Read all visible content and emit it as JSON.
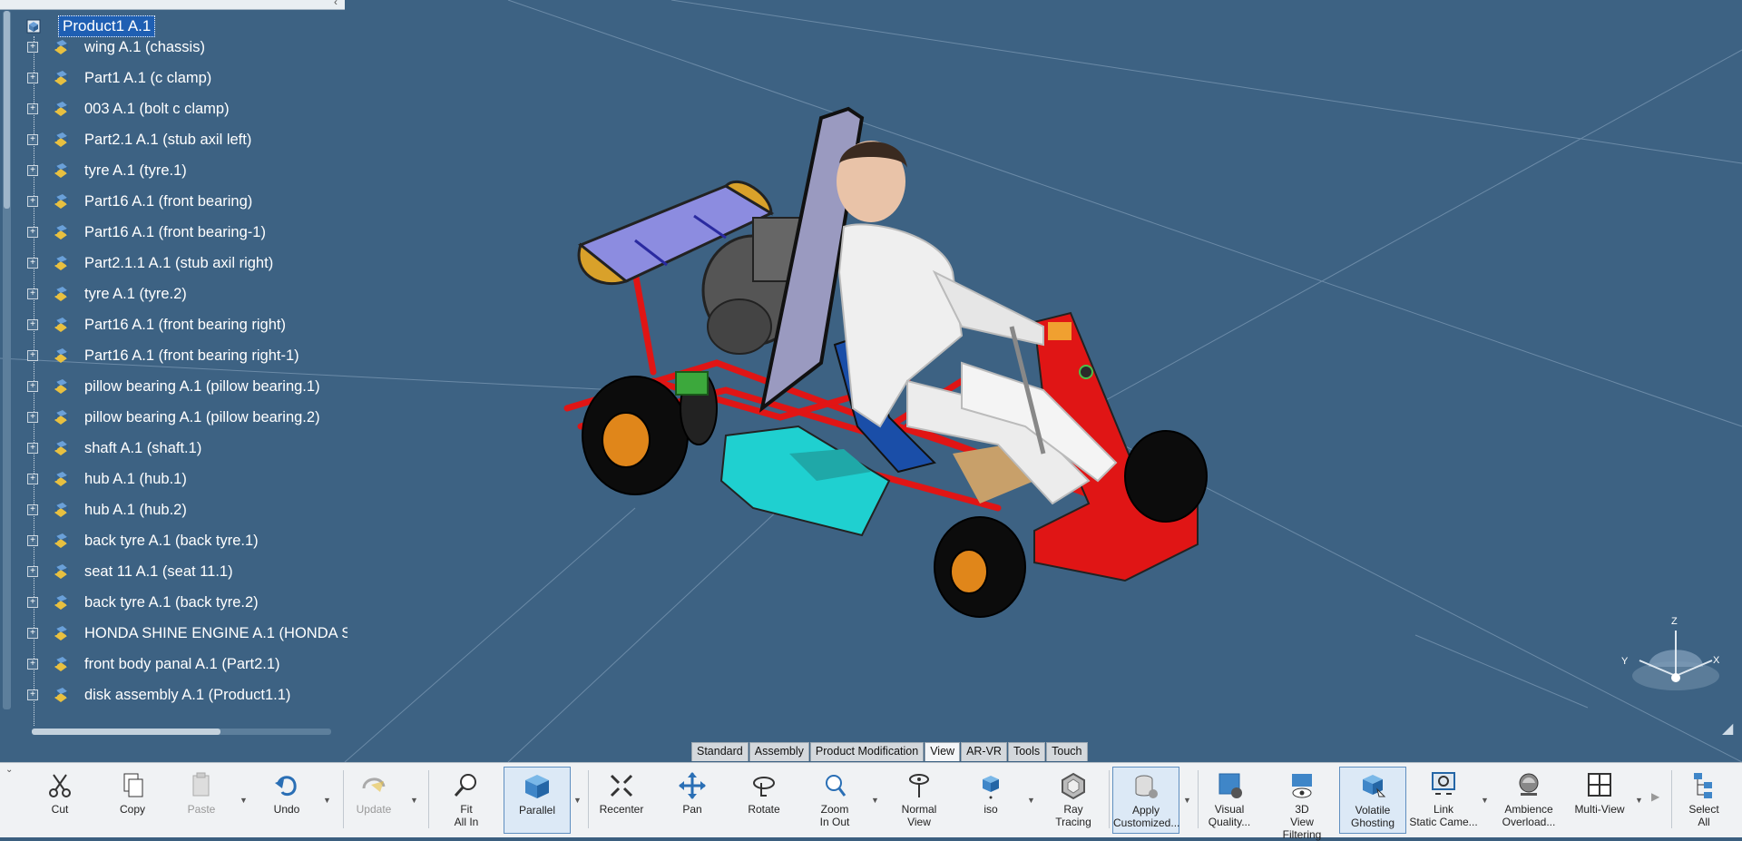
{
  "tree": {
    "root": "Product1 A.1",
    "items": [
      {
        "label": "wing A.1 (chassis)"
      },
      {
        "label": "Part1 A.1 (c clamp)"
      },
      {
        "label": "003 A.1 (bolt c clamp)"
      },
      {
        "label": "Part2.1 A.1 (stub axil left)"
      },
      {
        "label": "tyre A.1 (tyre.1)"
      },
      {
        "label": "Part16 A.1 (front bearing)"
      },
      {
        "label": "Part16 A.1 (front bearing-1)"
      },
      {
        "label": "Part2.1.1 A.1 (stub axil right)"
      },
      {
        "label": "tyre A.1 (tyre.2)"
      },
      {
        "label": "Part16 A.1 (front bearing right)"
      },
      {
        "label": "Part16 A.1 (front bearing right-1)"
      },
      {
        "label": "pillow bearing A.1 (pillow bearing.1)"
      },
      {
        "label": "pillow bearing A.1 (pillow bearing.2)"
      },
      {
        "label": "shaft A.1 (shaft.1)"
      },
      {
        "label": "hub A.1 (hub.1)"
      },
      {
        "label": "hub A.1 (hub.2)"
      },
      {
        "label": "back tyre A.1 (back tyre.1)"
      },
      {
        "label": "seat 11 A.1 (seat 11.1)"
      },
      {
        "label": "back tyre A.1 (back tyre.2)"
      },
      {
        "label": "HONDA SHINE ENGINE A.1 (HONDA S"
      },
      {
        "label": "front body panal A.1 (Part2.1)"
      },
      {
        "label": "disk assembly A.1 (Product1.1)"
      }
    ]
  },
  "tabs": [
    "Standard",
    "Assembly",
    "Product Modification",
    "View",
    "AR-VR",
    "Tools",
    "Touch"
  ],
  "active_tab": "View",
  "toolbar": {
    "cut": "Cut",
    "copy": "Copy",
    "paste": "Paste",
    "undo": "Undo",
    "update": "Update",
    "fit_all_in": [
      "Fit",
      "All In"
    ],
    "parallel": "Parallel",
    "recenter": "Recenter",
    "pan": "Pan",
    "rotate": "Rotate",
    "zoom_in_out": [
      "Zoom",
      "In Out"
    ],
    "normal_view": [
      "Normal",
      "View"
    ],
    "iso": "iso",
    "ray_tracing": [
      "Ray",
      "Tracing"
    ],
    "apply_customized": [
      "Apply",
      "Customized..."
    ],
    "visual_quality": [
      "Visual",
      "Quality..."
    ],
    "view_filtering": [
      "3D",
      "View Filtering"
    ],
    "volatile_ghosting": [
      "Volatile",
      "Ghosting"
    ],
    "link_static_camera": [
      "Link",
      "Static Came..."
    ],
    "ambience_overload": [
      "Ambience",
      "Overload..."
    ],
    "multi_view": "Multi-View",
    "select_all": [
      "Select",
      "All"
    ]
  },
  "compass_axes": {
    "z": "Z",
    "x": "X",
    "y": "Y"
  },
  "colors": {
    "background": "#3d6283",
    "selection": "#1f5fb3",
    "kart_frame": "#e01515",
    "body_panel": "#1fd0d0",
    "wing": "#8c8ce0"
  }
}
